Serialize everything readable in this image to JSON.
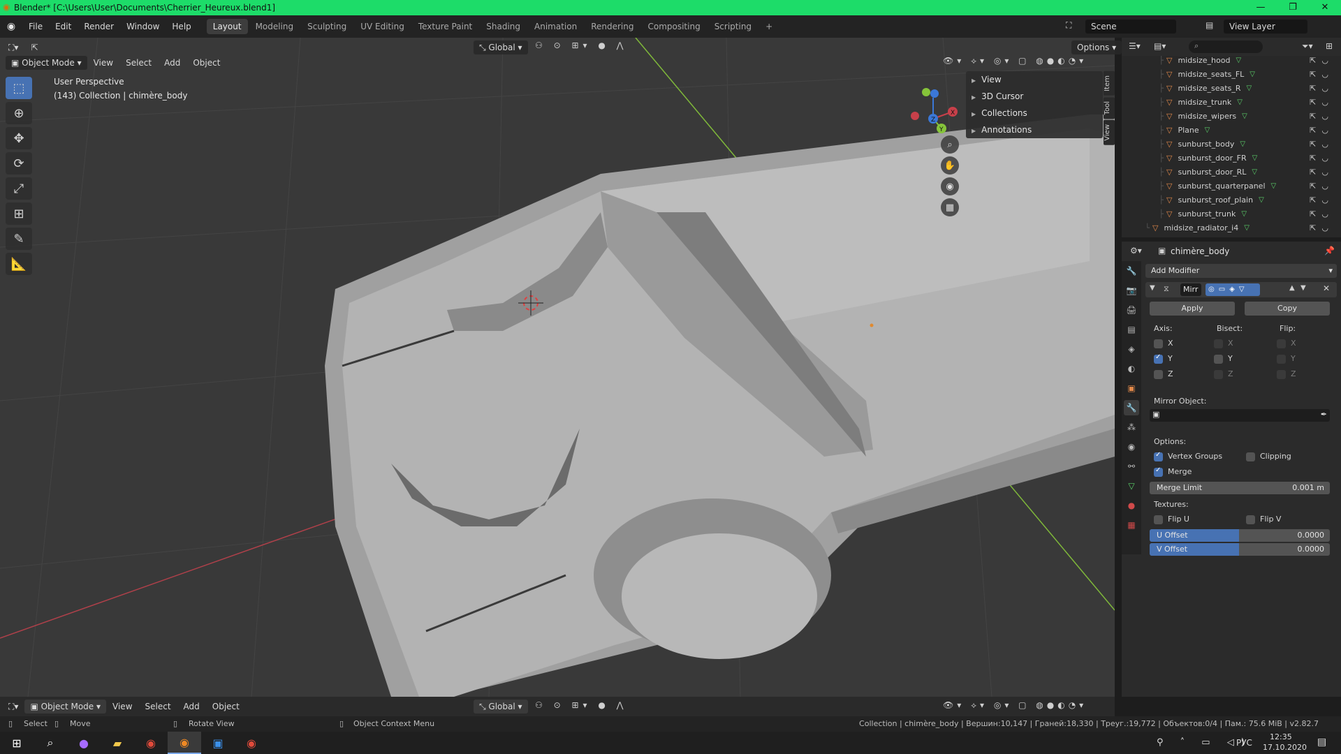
{
  "window": {
    "title": "Blender* [C:\\Users\\User\\Documents\\Cherrier_Heureux.blend1]",
    "controls": [
      "—",
      "❐",
      "✕"
    ]
  },
  "menubar": {
    "items": [
      "File",
      "Edit",
      "Render",
      "Window",
      "Help"
    ],
    "workspaces": [
      "Layout",
      "Modeling",
      "Sculpting",
      "UV Editing",
      "Texture Paint",
      "Shading",
      "Animation",
      "Rendering",
      "Compositing",
      "Scripting",
      "+"
    ],
    "active_workspace": "Layout",
    "scene": "Scene",
    "view_layer": "View Layer"
  },
  "viewport": {
    "mode": "Object Mode",
    "menus": [
      "View",
      "Select",
      "Add",
      "Object"
    ],
    "orientation": "Global",
    "options_label": "Options",
    "perspective_label": "User Perspective",
    "collection_label": "(143) Collection | chimère_body",
    "npanel": {
      "rows": [
        "View",
        "3D Cursor",
        "Collections",
        "Annotations"
      ],
      "tabs": [
        "Item",
        "Tool",
        "View"
      ]
    },
    "gizmo_axes": [
      "X",
      "Y",
      "Z"
    ],
    "colors": {
      "background": "#393939",
      "x_axis": "#c8404a",
      "y_axis": "#86c43a",
      "z_axis": "#3b78d8",
      "select_active": "#4772b3"
    }
  },
  "outliner": {
    "search_placeholder": "",
    "items": [
      {
        "name": "midsize_hood",
        "indent": 1
      },
      {
        "name": "midsize_seats_FL",
        "indent": 1
      },
      {
        "name": "midsize_seats_R",
        "indent": 1
      },
      {
        "name": "midsize_trunk",
        "indent": 1
      },
      {
        "name": "midsize_wipers",
        "indent": 1
      },
      {
        "name": "Plane",
        "indent": 1
      },
      {
        "name": "sunburst_body",
        "indent": 1
      },
      {
        "name": "sunburst_door_FR",
        "indent": 1
      },
      {
        "name": "sunburst_door_RL",
        "indent": 1
      },
      {
        "name": "sunburst_quarterpanel",
        "indent": 1
      },
      {
        "name": "sunburst_roof_plain",
        "indent": 1
      },
      {
        "name": "sunburst_trunk",
        "indent": 1
      },
      {
        "name": "midsize_radiator_i4",
        "indent": 0
      }
    ]
  },
  "properties": {
    "object_name": "chimère_body",
    "add_modifier": "Add Modifier",
    "modifier_name": "Mirr",
    "apply_label": "Apply",
    "copy_label": "Copy",
    "axis_label": "Axis:",
    "bisect_label": "Bisect:",
    "flip_label": "Flip:",
    "axes": [
      "X",
      "Y",
      "Z"
    ],
    "axis_checked": [
      false,
      true,
      false
    ],
    "mirror_object_label": "Mirror Object:",
    "options_label": "Options:",
    "vertex_groups_label": "Vertex Groups",
    "vertex_groups": true,
    "clipping_label": "Clipping",
    "clipping": false,
    "merge_label": "Merge",
    "merge": true,
    "merge_limit_label": "Merge Limit",
    "merge_limit_value": "0.001 m",
    "textures_label": "Textures:",
    "flip_u_label": "Flip U",
    "flip_v_label": "Flip V",
    "u_offset_label": "U Offset",
    "u_offset_value": "0.0000",
    "v_offset_label": "V Offset",
    "v_offset_value": "0.0000"
  },
  "footer": {
    "mode": "Object Mode",
    "menus": [
      "View",
      "Select",
      "Add",
      "Object"
    ],
    "orientation": "Global"
  },
  "statusbar": {
    "select": "Select",
    "move": "Move",
    "rotate": "Rotate View",
    "context_menu": "Object Context Menu",
    "stats": "Collection | chimère_body | Вершин:10,147 | Граней:18,330 | Треуг.:19,772 | Объектов:0/4 | Пам.: 75.6 MiB | v2.82.7"
  },
  "taskbar": {
    "lang": "РУС",
    "time": "12:35",
    "date": "17.10.2020"
  }
}
